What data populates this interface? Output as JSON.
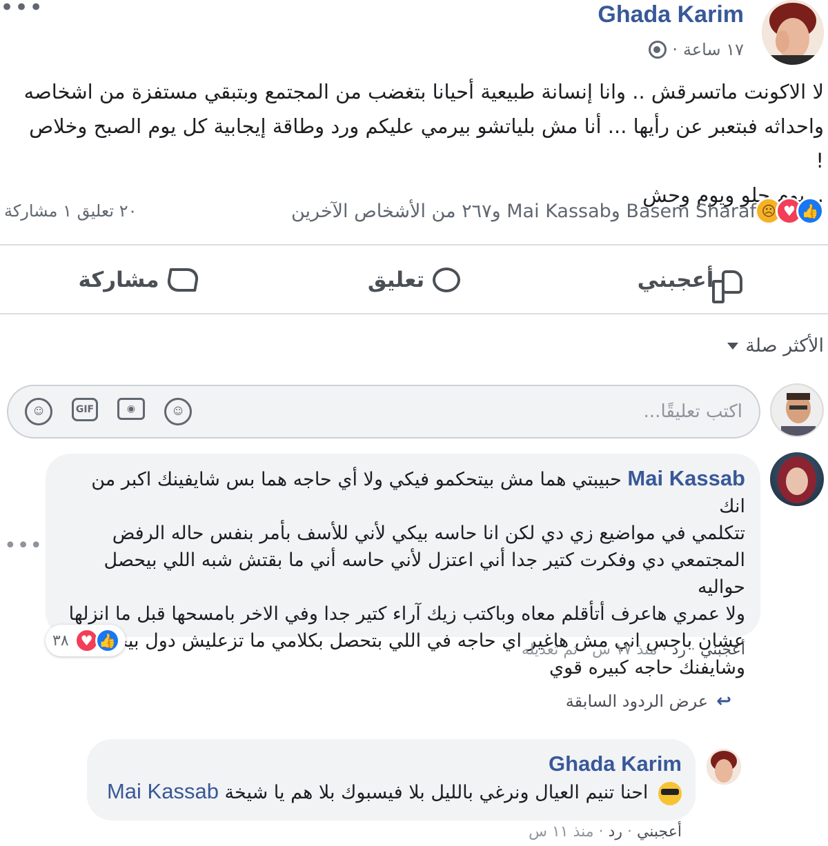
{
  "post": {
    "author": "Ghada Karim",
    "time": "١٧ ساعة",
    "time_separator": "·",
    "text_lines": [
      "لا الاكونت ماتسرقش .. وانا إنسانة طبيعية أحيانا بتغضب من المجتمع وبتبقي مستفزة من اشخاصه",
      "واحداثه فبتعبر عن رأيها ... أنا مش بلياتشو بيرمي عليكم ورد وطاقة إيجابية كل يوم الصبح وخلاص !",
      ".. يوم حلو ويوم وحش"
    ],
    "reactions_summary": "Basem Sharaf وMai Kassab و٢٦٧ من الأشخاص الآخرين",
    "counts": "٢٠ تعليق  ١ مشاركة",
    "reaction_icons": [
      "like-icon",
      "love-icon",
      "sad-icon"
    ]
  },
  "actions": {
    "like": "أعجبني",
    "comment": "تعليق",
    "share": "مشاركة"
  },
  "sort": {
    "label": "الأكثر صلة"
  },
  "composer": {
    "placeholder": "اكتب تعليقًا...",
    "icons": [
      "emoji-icon",
      "camera-icon",
      "gif-icon",
      "sticker-icon"
    ],
    "gif_label": "GIF"
  },
  "comments": [
    {
      "author": "Mai Kassab",
      "lines": [
        "حبيبتي هما مش بيتحكمو فيكي ولا أي حاجه هما بس شايفينك اكبر من انك",
        "تتكلمي في مواضيع زي دي لكن انا حاسه بيكي لأني للأسف بأمر بنفس حاله الرفض",
        "المجتمعي دي وفكرت كتير جدا أني اعتزل لأني حاسه أني ما بقتش شبه اللي بيحصل حواليه",
        "ولا عمري هاعرف أتأقلم معاه وباكتب زيك آراء كتير جدا وفي الاخر بامسحها قبل ما انزلها",
        "عشان باحس اني مش هاغير اي حاجه في اللي بتحصل بكلامي ما تزعليش دول بيحبوكي",
        "وشايفنك حاجه كبيره قوي"
      ],
      "reaction_count": "٣٨",
      "like": "أعجبني",
      "reply": "رد",
      "time": "منذ ١٧ س",
      "edited": "تم تعديله",
      "separator": " · "
    }
  ],
  "previous_replies": "عرض الردود السابقة",
  "reply": {
    "author": "Ghada Karim",
    "text": "احنا تنيم العيال ونرغي بالليل بلا فيسبوك بلا هم يا شيخة",
    "mention": "Mai Kassab",
    "like": "أعجبني",
    "reply": "رد",
    "time": "منذ ١١ س",
    "separator": " · "
  },
  "colors": {
    "link": "#385898",
    "like_blue": "#1877f2",
    "love_red": "#f33e58",
    "bubble_bg": "#f2f3f5"
  }
}
